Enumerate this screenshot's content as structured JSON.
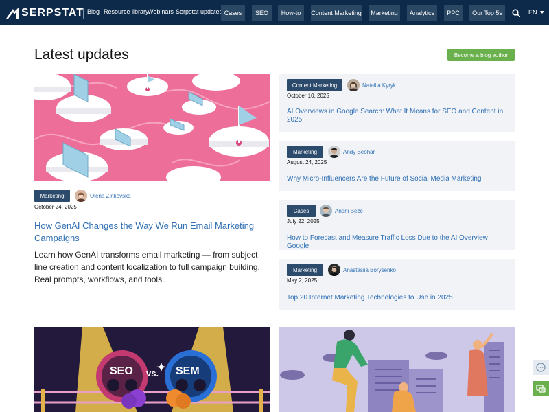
{
  "nav": {
    "logo_text": "SERPSTAT",
    "links": [
      "Blog",
      "Resource library",
      "Webinars",
      "Serpstat updates"
    ],
    "buttons": [
      "Cases",
      "SEO",
      "How-to",
      "Content Marketing",
      "Marketing",
      "Analytics",
      "PPC",
      "Our Top 5s"
    ],
    "lang": "EN"
  },
  "page": {
    "title": "Latest updates",
    "blog_author_button": "Become a blog author"
  },
  "featured": {
    "tag": "Marketing",
    "author": "Olena Zinkovska",
    "date": "October 24, 2025",
    "title": "How GenAI Changes the Way We Run Email Marketing Campaigns",
    "excerpt": "Learn how GenAI transforms email marketing — from subject line creation and content localization to full campaign building. Real prompts, workflows, and tools."
  },
  "cards": [
    {
      "tag": "Content Marketing",
      "author": "Nataliia Kyryk",
      "date": "October 10, 2025",
      "title": "AI Overviews in Google Search: What It Means for SEO and Content in 2025"
    },
    {
      "tag": "Marketing",
      "author": "Andy Beohar",
      "date": "August 24, 2025",
      "title": "Why Micro-Influencers Are the Future of Social Media Marketing"
    },
    {
      "tag": "Cases",
      "author": "Andrii Beze",
      "date": "July 22, 2025",
      "title": "How to Forecast and Measure Traffic Loss Due to the AI Overview Google"
    },
    {
      "tag": "Marketing",
      "author": "Anastasiia Borysenko",
      "date": "May 2, 2025",
      "title": "Top 20 Internet Marketing Technologies to Use in 2025"
    }
  ],
  "bottom": {
    "seo_label": "SEO",
    "vs_label": "vs.",
    "sem_label": "SEM"
  },
  "colors": {
    "nav_bg": "#0d2a4a",
    "nav_button": "#2a4764",
    "tag_bg": "#2c4a6b",
    "link": "#2f6fb4",
    "accent_green": "#6ab04c",
    "card_bg": "#f1f3f6"
  }
}
